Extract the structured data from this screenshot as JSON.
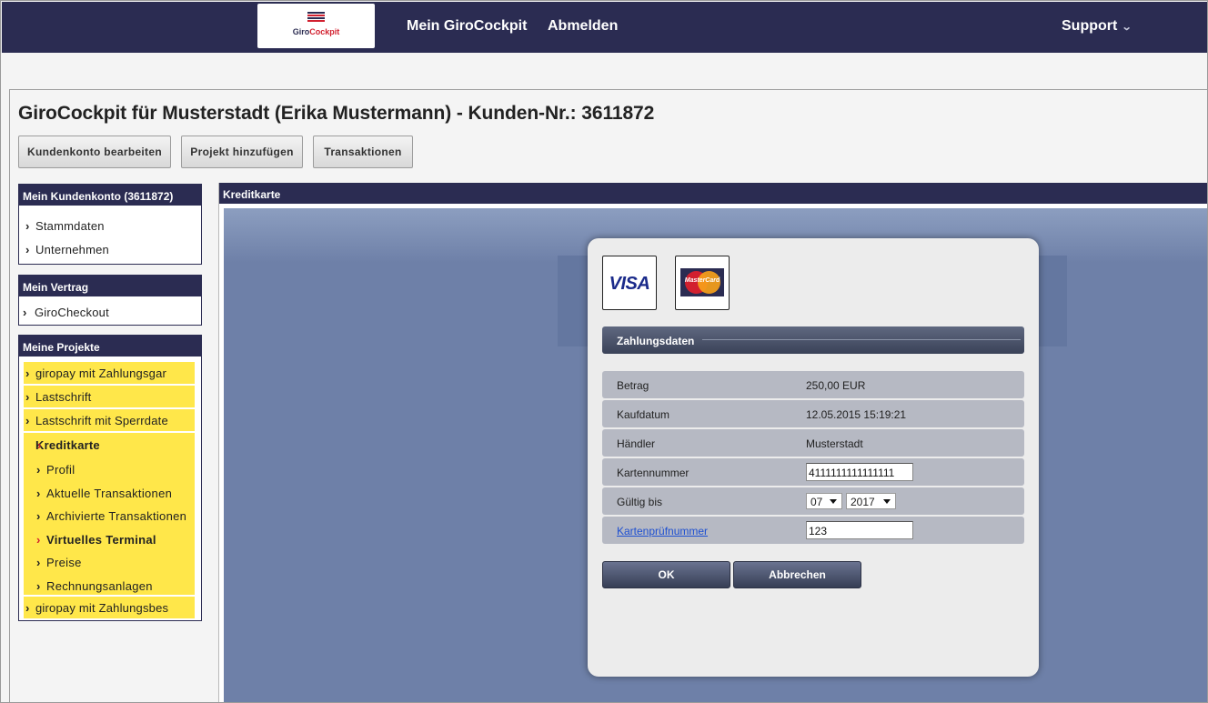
{
  "logo": {
    "text_prefix": "Giro",
    "text_suffix": "Cockpit",
    "brand_color": "#2b2c52",
    "accent_color": "#d2202f"
  },
  "nav": {
    "mein_girocockpit": "Mein GiroCockpit",
    "abmelden": "Abmelden",
    "support": "Support"
  },
  "page": {
    "title": "GiroCockpit für Musterstadt (Erika Mustermann) - Kunden-Nr.: 3611872",
    "buttons": {
      "edit_account": "Kundenkonto bearbeiten",
      "add_project": "Projekt hinzufügen",
      "transactions": "Transaktionen"
    }
  },
  "sidebar": {
    "account": {
      "heading": "Mein Kundenkonto (3611872)",
      "items": [
        "Stammdaten",
        "Unternehmen"
      ]
    },
    "contract": {
      "heading": "Mein Vertrag",
      "items": [
        "GiroCheckout"
      ]
    },
    "projects": {
      "heading": "Meine Projekte",
      "items": [
        "giropay mit Zahlungsgar",
        "Lastschrift",
        "Lastschrift mit Sperrdate"
      ],
      "active": "Kreditkarte",
      "sub_items": [
        "Profil",
        "Aktuelle Transaktionen",
        "Archivierte Transaktionen",
        "Virtuelles Terminal",
        "Preise",
        "Rechnungsanlagen"
      ],
      "active_sub": "Virtuelles Terminal",
      "last_item": "giropay mit Zahlungsbes"
    }
  },
  "panel": {
    "heading": "Kreditkarte"
  },
  "dialog": {
    "visa_label": "VISA",
    "mastercard_label": "MasterCard",
    "section_title": "Zahlungsdaten",
    "fields": {
      "amount_label": "Betrag",
      "amount_value": "250,00 EUR",
      "date_label": "Kaufdatum",
      "date_value": "12.05.2015 15:19:21",
      "merchant_label": "Händler",
      "merchant_value": "Musterstadt",
      "card_number_label": "Kartennummer",
      "card_number_value": "4111111111111111",
      "valid_until_label": "Gültig bis",
      "valid_month": "07",
      "valid_year": "2017",
      "cvc_label": "Kartenprüfnummer",
      "cvc_value": "123"
    },
    "ok_label": "OK",
    "cancel_label": "Abbrechen"
  }
}
